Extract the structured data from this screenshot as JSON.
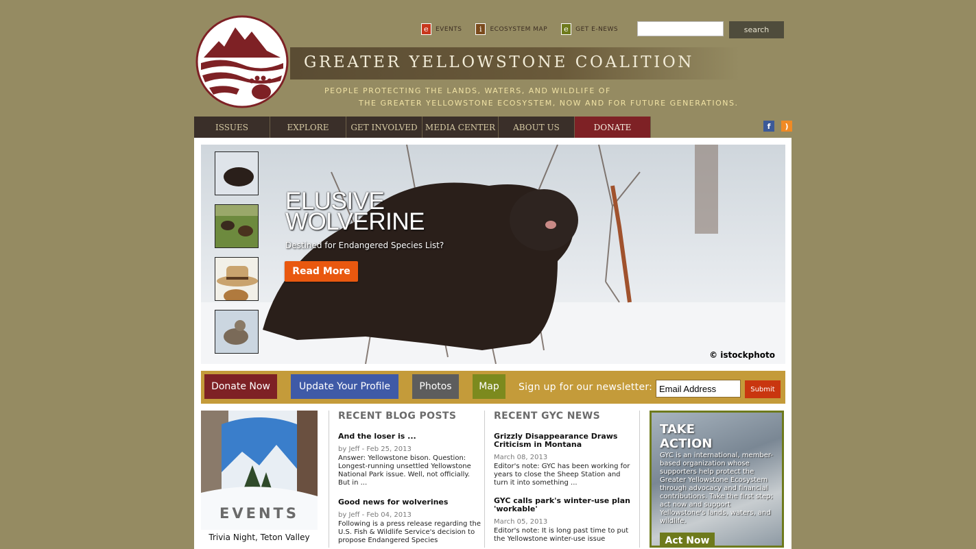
{
  "header": {
    "title": "GREATER YELLOWSTONE COALITION",
    "tagline_line1": "PEOPLE PROTECTING THE LANDS, WATERS, AND WILDLIFE OF",
    "tagline_line2": "THE GREATER YELLOWSTONE ECOSYSTEM, NOW AND FOR FUTURE GENERATIONS."
  },
  "toplinks": [
    {
      "letter": "e",
      "label": "EVENTS",
      "color": "#c8361c"
    },
    {
      "letter": "i",
      "label": "ECOSYSTEM MAP",
      "color": "#7a4a1c"
    },
    {
      "letter": "e",
      "label": "GET E-NEWS",
      "color": "#6e7a1c"
    }
  ],
  "search": {
    "button_label": "search",
    "value": ""
  },
  "nav": [
    "ISSUES",
    "EXPLORE",
    "GET INVOLVED",
    "MEDIA CENTER",
    "ABOUT US",
    "DONATE"
  ],
  "hero": {
    "title_line1": "ELUSIVE",
    "title_line2": "WOLVERINE",
    "subtitle": "Destined for Endangered Species List?",
    "button_label": "Read More",
    "credit": "© istockphoto"
  },
  "actionbar": {
    "donate": "Donate Now",
    "profile": "Update Your Profile",
    "photos": "Photos",
    "map": "Map",
    "signup_label": "Sign up for our newsletter:",
    "email_value": "Email Address",
    "submit": "Submit"
  },
  "events": {
    "label": "EVENTS",
    "caption": "Trivia Night, Teton Valley"
  },
  "blog": {
    "heading": "RECENT BLOG POSTS",
    "posts": [
      {
        "title": "And the loser is ...",
        "meta": "by Jeff - Feb 25, 2013",
        "excerpt": "Answer: Yellowstone bison. Question: Longest-running unsettled Yellowstone National Park issue. Well, not officially. But in ..."
      },
      {
        "title": "Good news for wolverines",
        "meta": "by Jeff - Feb 04, 2013",
        "excerpt": "Following is a press release regarding the U.S. Fish & Wildlife Service's decision to propose Endangered Species"
      }
    ]
  },
  "news": {
    "heading": "RECENT GYC NEWS",
    "posts": [
      {
        "title": "Grizzly Disappearance Draws Criticism in Montana",
        "meta": "March 08, 2013",
        "excerpt": "Editor's note: GYC has been working for years to close the Sheep Station and turn it into something ..."
      },
      {
        "title": "GYC calls park's winter-use plan 'workable'",
        "meta": "March 05, 2013",
        "excerpt": "Editor's note: It is long past time to put the Yellowstone winter-use issue"
      }
    ]
  },
  "take_action": {
    "title_line1": "TAKE",
    "title_line2": "ACTION",
    "body": "GYC is an international, member-based organization whose supporters help protect the Greater Yellowstone Ecosystem through advocacy and financial contributions. Take the first step; act now and support Yellowstone's lands, waters, and wildlife.",
    "button": "Act Now"
  },
  "social": {
    "facebook": "f",
    "rss": ")"
  },
  "colors": {
    "page_bg": "#958b62",
    "nav_bg": "#3a2f29",
    "donate": "#7e2125",
    "accent_orange": "#e9580f",
    "bar_gold": "#c49b3a"
  }
}
